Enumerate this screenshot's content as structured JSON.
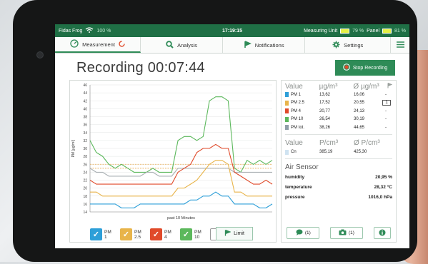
{
  "status": {
    "app": "Fidas Frog",
    "wifi_pct": "100 %",
    "time": "17:19:15",
    "measuring_unit": "Measuring Unit",
    "measuring_pct": "79 %",
    "panel": "Panel",
    "panel_pct": "81 %"
  },
  "nav": {
    "tabs": [
      {
        "label": "Measurement"
      },
      {
        "label": "Analysis"
      },
      {
        "label": "Notifications"
      },
      {
        "label": "Settings"
      }
    ]
  },
  "recording": {
    "title": "Recording 00:07:44",
    "stop_label": "Stop Recording"
  },
  "chart_data": {
    "type": "line",
    "ylabel": "PM [µg/m³]",
    "xlabel": "past 10 Minutes",
    "ylim": [
      14,
      46
    ],
    "y_ticks": [
      "46",
      "44",
      "42",
      "40",
      "38",
      "36",
      "34",
      "32",
      "30",
      "28",
      "26",
      "24",
      "22",
      "20",
      "18",
      "16",
      "14"
    ],
    "x": [
      0,
      1,
      2,
      3,
      4,
      5,
      6,
      7,
      8,
      9,
      10,
      11,
      12,
      13,
      14,
      15,
      16,
      17,
      18,
      19,
      20,
      21,
      22,
      23,
      24,
      25,
      26,
      27,
      28,
      29
    ],
    "series": [
      {
        "name": "PM 10",
        "color": "#5cb85c",
        "values": [
          32,
          29,
          28,
          26,
          25,
          26,
          25,
          24,
          24,
          24,
          25,
          24,
          24,
          24,
          32,
          33,
          33,
          32,
          33,
          42,
          43,
          43,
          42,
          25,
          24,
          27,
          26,
          27,
          26,
          27
        ]
      },
      {
        "name": "PM tot.",
        "color": "#aab0b4",
        "values": [
          25,
          24,
          24,
          23,
          23,
          23,
          23,
          23,
          23,
          24,
          24,
          23,
          23,
          23,
          25,
          25,
          25,
          25,
          25,
          25,
          25,
          25,
          25,
          24,
          24,
          24,
          24,
          24,
          24,
          24
        ]
      },
      {
        "name": "PM 4",
        "color": "#e04a2a",
        "values": [
          22,
          21,
          21,
          21,
          21,
          21,
          21,
          21,
          21,
          21,
          21,
          21,
          21,
          21,
          24,
          25,
          26,
          29,
          30,
          30,
          31,
          30,
          30,
          24,
          23,
          22,
          21,
          21,
          22,
          21
        ]
      },
      {
        "name": "PM 2.5",
        "color": "#e8b44a",
        "values": [
          19,
          19,
          18,
          18,
          18,
          18,
          18,
          18,
          18,
          18,
          18,
          18,
          18,
          18,
          20,
          20,
          21,
          22,
          24,
          26,
          27,
          27,
          26,
          19,
          19,
          18,
          18,
          18,
          18,
          18
        ]
      },
      {
        "name": "PM 1",
        "color": "#2e9fd8",
        "values": [
          16,
          16,
          16,
          16,
          16,
          15,
          15,
          15,
          16,
          16,
          16,
          16,
          16,
          16,
          16,
          16,
          17,
          17,
          18,
          18,
          19,
          18,
          18,
          16,
          16,
          16,
          16,
          15,
          15,
          16
        ]
      }
    ],
    "limit_lines": [
      {
        "color": "#e8a84a",
        "value": 25
      },
      {
        "color": "#e8a84a",
        "value": 26
      }
    ]
  },
  "legend": [
    {
      "label1": "PM",
      "label2": "1",
      "color": "#2e9fd8",
      "checked": true
    },
    {
      "label1": "PM",
      "label2": "2.5",
      "color": "#e8b44a",
      "checked": true
    },
    {
      "label1": "PM",
      "label2": "4",
      "color": "#e04a2a",
      "checked": true
    },
    {
      "label1": "PM",
      "label2": "10",
      "color": "#5cb85c",
      "checked": true
    },
    {
      "label1": "PM",
      "label2": "tot.",
      "color": "#ffffff",
      "checked": false
    }
  ],
  "limit_label": "Limit",
  "table": {
    "head": {
      "value": "Value",
      "unit": "µg/m³",
      "avg": "Ø µg/m³"
    },
    "rows": [
      {
        "name": "PM 1",
        "color": "#2e9fd8",
        "value": "13,62",
        "avg": "16,06",
        "extra": "-"
      },
      {
        "name": "PM 2.5",
        "color": "#e8b44a",
        "value": "17,52",
        "avg": "20,55",
        "extra": "1"
      },
      {
        "name": "PM 4",
        "color": "#e04a2a",
        "value": "20,77",
        "avg": "24,13",
        "extra": "-"
      },
      {
        "name": "PM 10",
        "color": "#5cb85c",
        "value": "26,54",
        "avg": "30,19",
        "extra": "-"
      },
      {
        "name": "PM tot.",
        "color": "#8f9ea8",
        "value": "38,26",
        "avg": "44,65",
        "extra": "-"
      }
    ],
    "head2": {
      "value": "Value",
      "unit": "P/cm³",
      "avg": "Ø P/cm³"
    },
    "cn": {
      "name": "Cn",
      "color": "#cfe3f1",
      "value": "385,19",
      "avg": "425,30"
    }
  },
  "air": {
    "title": "Air Sensor",
    "rows": [
      {
        "name": "humidity",
        "value": "20,95 %"
      },
      {
        "name": "temperature",
        "value": "28,32 °C"
      },
      {
        "name": "pressure",
        "value": "1016,0 hPa"
      }
    ]
  },
  "buttons": {
    "comments": "(1)",
    "photos": "(1)"
  }
}
